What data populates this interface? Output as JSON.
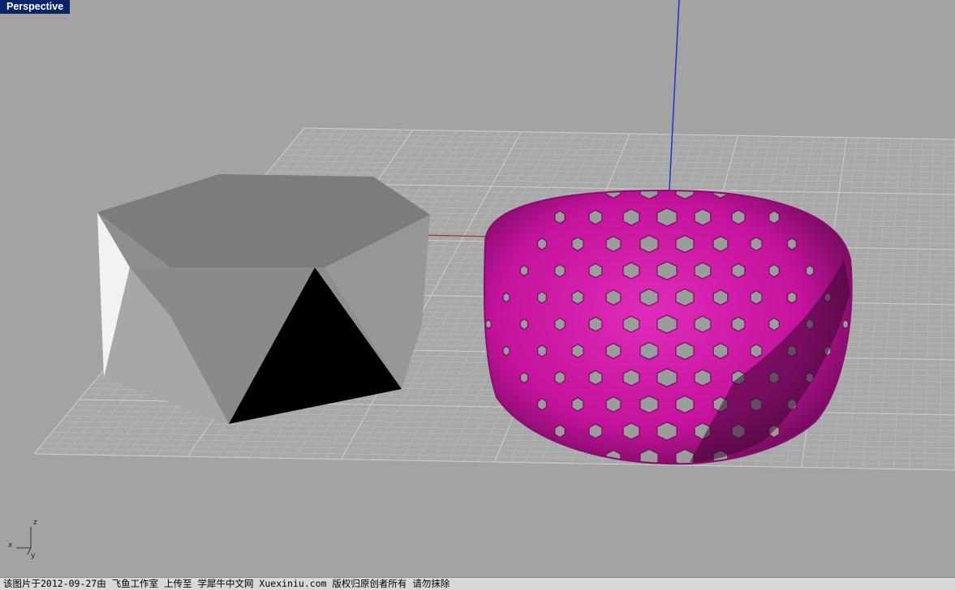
{
  "viewport": {
    "label": "Perspective",
    "background": "#a3a3a3"
  },
  "colors": {
    "grid_line": "#bdbdbd",
    "grid_major": "#cfcfcf",
    "x_axis": "#b02a2a",
    "y_axis": "#2a9a2a",
    "z_axis": "#2233cc",
    "polyhedron_light": "#a9a9a9",
    "polyhedron_mid": "#878787",
    "polyhedron_dark": "#000000",
    "lattice": "#c9139e",
    "lattice_shade": "#6a0a55"
  },
  "axis_icon": {
    "x": "x",
    "y": "y",
    "z": "z"
  },
  "objects": {
    "left_object": "faceted-polyhedron",
    "right_object": "woven-lattice-dome"
  },
  "status_bar": {
    "text": "该图片于2012-09-27由 飞鱼工作室 上传至 学犀牛中文网 Xuexiniu.com 版权归原创者所有 请勿抹除"
  }
}
